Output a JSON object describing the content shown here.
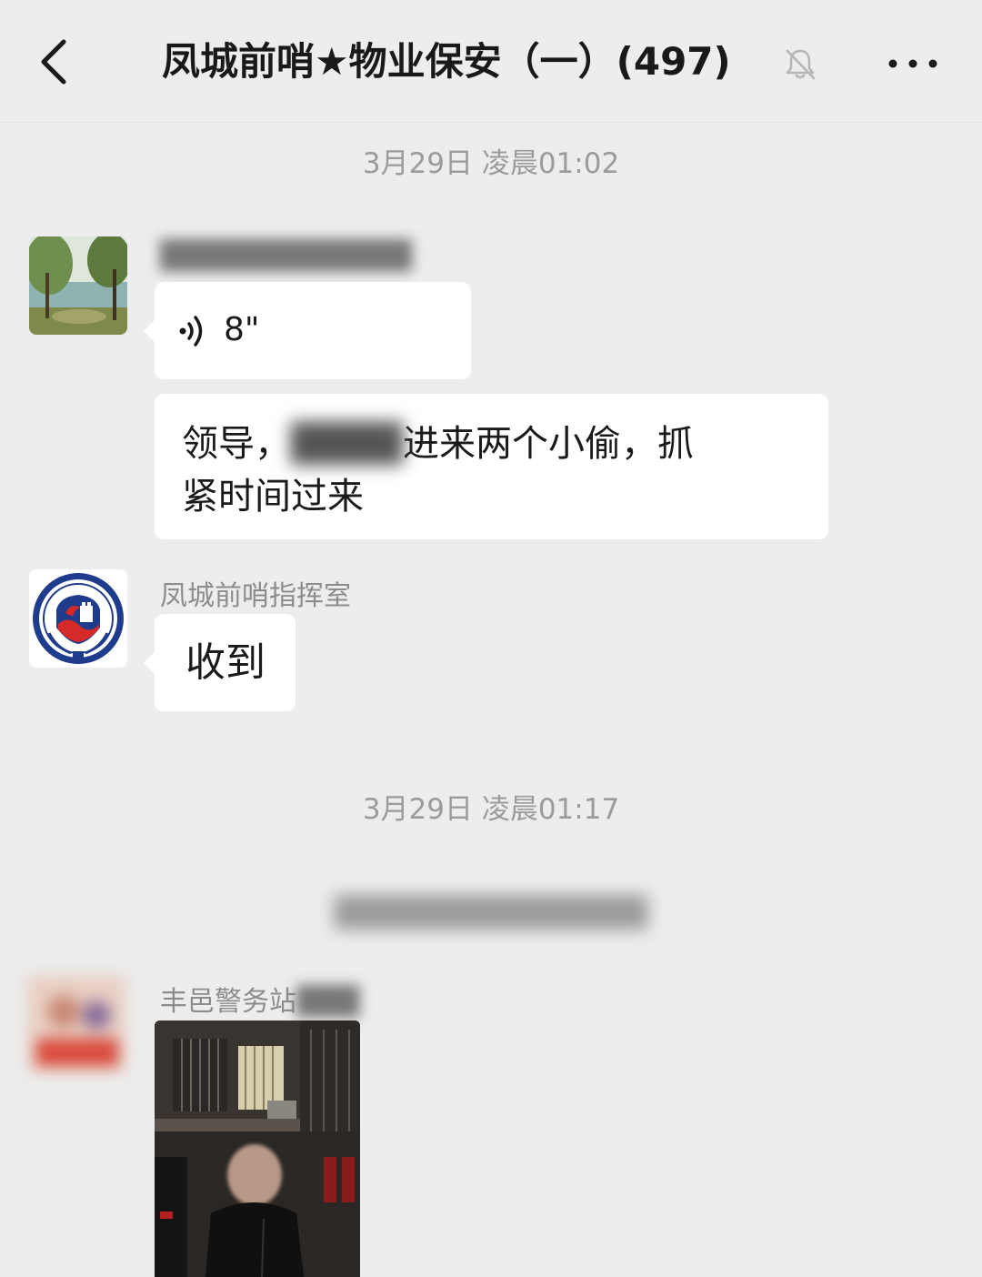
{
  "header": {
    "title": "凤城前哨★物业保安（一）(497)",
    "back_icon": "chevron-left-icon",
    "mute_icon": "bell-off-icon",
    "more_icon": "ellipsis-icon"
  },
  "messages": {
    "ts1": "3月29日 凌晨01:02",
    "voice": {
      "duration": "8\""
    },
    "text1": {
      "before": "领导，",
      "after": "进来两个小偷，抓",
      "line2": "紧时间过来"
    },
    "cmd": {
      "name": "凤城前哨指挥室",
      "text": "收到"
    },
    "ts2": "3月29日 凌晨01:17",
    "police": {
      "name": "丰邑警务站"
    }
  },
  "colors": {
    "background": "#ededed",
    "bubble": "#ffffff",
    "logo_blue": "#1f3c8c",
    "logo_red": "#d62a2a"
  }
}
